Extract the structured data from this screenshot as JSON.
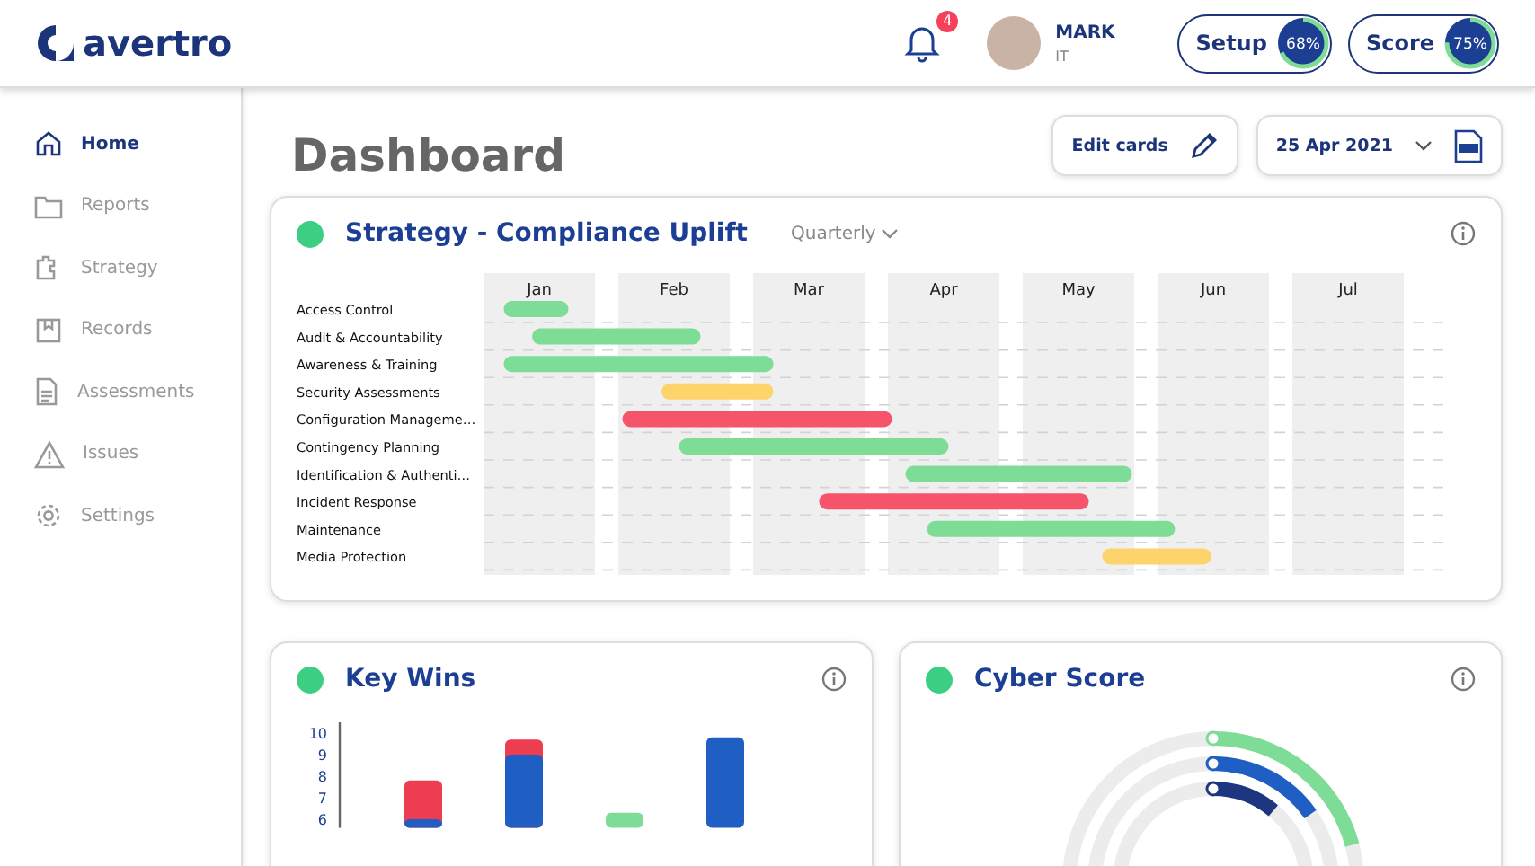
{
  "header": {
    "logo": "avertro",
    "notifications": {
      "count": "4"
    },
    "user": {
      "name": "MARK",
      "role": "IT"
    },
    "progress": [
      {
        "label": "Setup",
        "reading": "68%",
        "level": 0.68
      },
      {
        "label": "Score",
        "reading": "75%",
        "level": 0.75
      }
    ]
  },
  "sidebar": {
    "items": [
      {
        "label": "Home",
        "selected": true
      },
      {
        "label": "Reports",
        "selected": false
      },
      {
        "label": "Strategy",
        "selected": false
      },
      {
        "label": "Records",
        "selected": false
      },
      {
        "label": "Assessments",
        "selected": false
      },
      {
        "label": "Issues",
        "selected": false
      },
      {
        "label": "Settings",
        "selected": false
      }
    ]
  },
  "page": {
    "title": "Dashboard",
    "edit_button": "Edit cards",
    "date": "25 Apr 2021"
  },
  "strategy_card": {
    "title": "Strategy - Compliance Uplift",
    "period": "Quarterly",
    "months": [
      "Jan",
      "Feb",
      "Mar",
      "Apr",
      "May",
      "Jun",
      "Jul"
    ],
    "rows": [
      {
        "label": "Access Control",
        "color": "#7ddc95"
      },
      {
        "label": "Audit & Accountability",
        "color": "#7ddc95"
      },
      {
        "label": "Awareness & Training",
        "color": "#7ddc95"
      },
      {
        "label": "Security Assessments",
        "color": "#fdd46b"
      },
      {
        "label": "Configuration Manageme…",
        "color": "#f5546a"
      },
      {
        "label": "Contingency Planning",
        "color": "#7ddc95"
      },
      {
        "label": "Identification & Authenti…",
        "color": "#7ddc95"
      },
      {
        "label": "Incident Response",
        "color": "#f5546a"
      },
      {
        "label": "Maintenance",
        "color": "#7ddc95"
      },
      {
        "label": "Media Protection",
        "color": "#fdd46b"
      }
    ]
  },
  "key_wins": {
    "title": "Key Wins",
    "y_labels": [
      "10",
      "9",
      "8",
      "7",
      "6"
    ]
  },
  "cyber_score": {
    "title": "Cyber Score"
  }
}
